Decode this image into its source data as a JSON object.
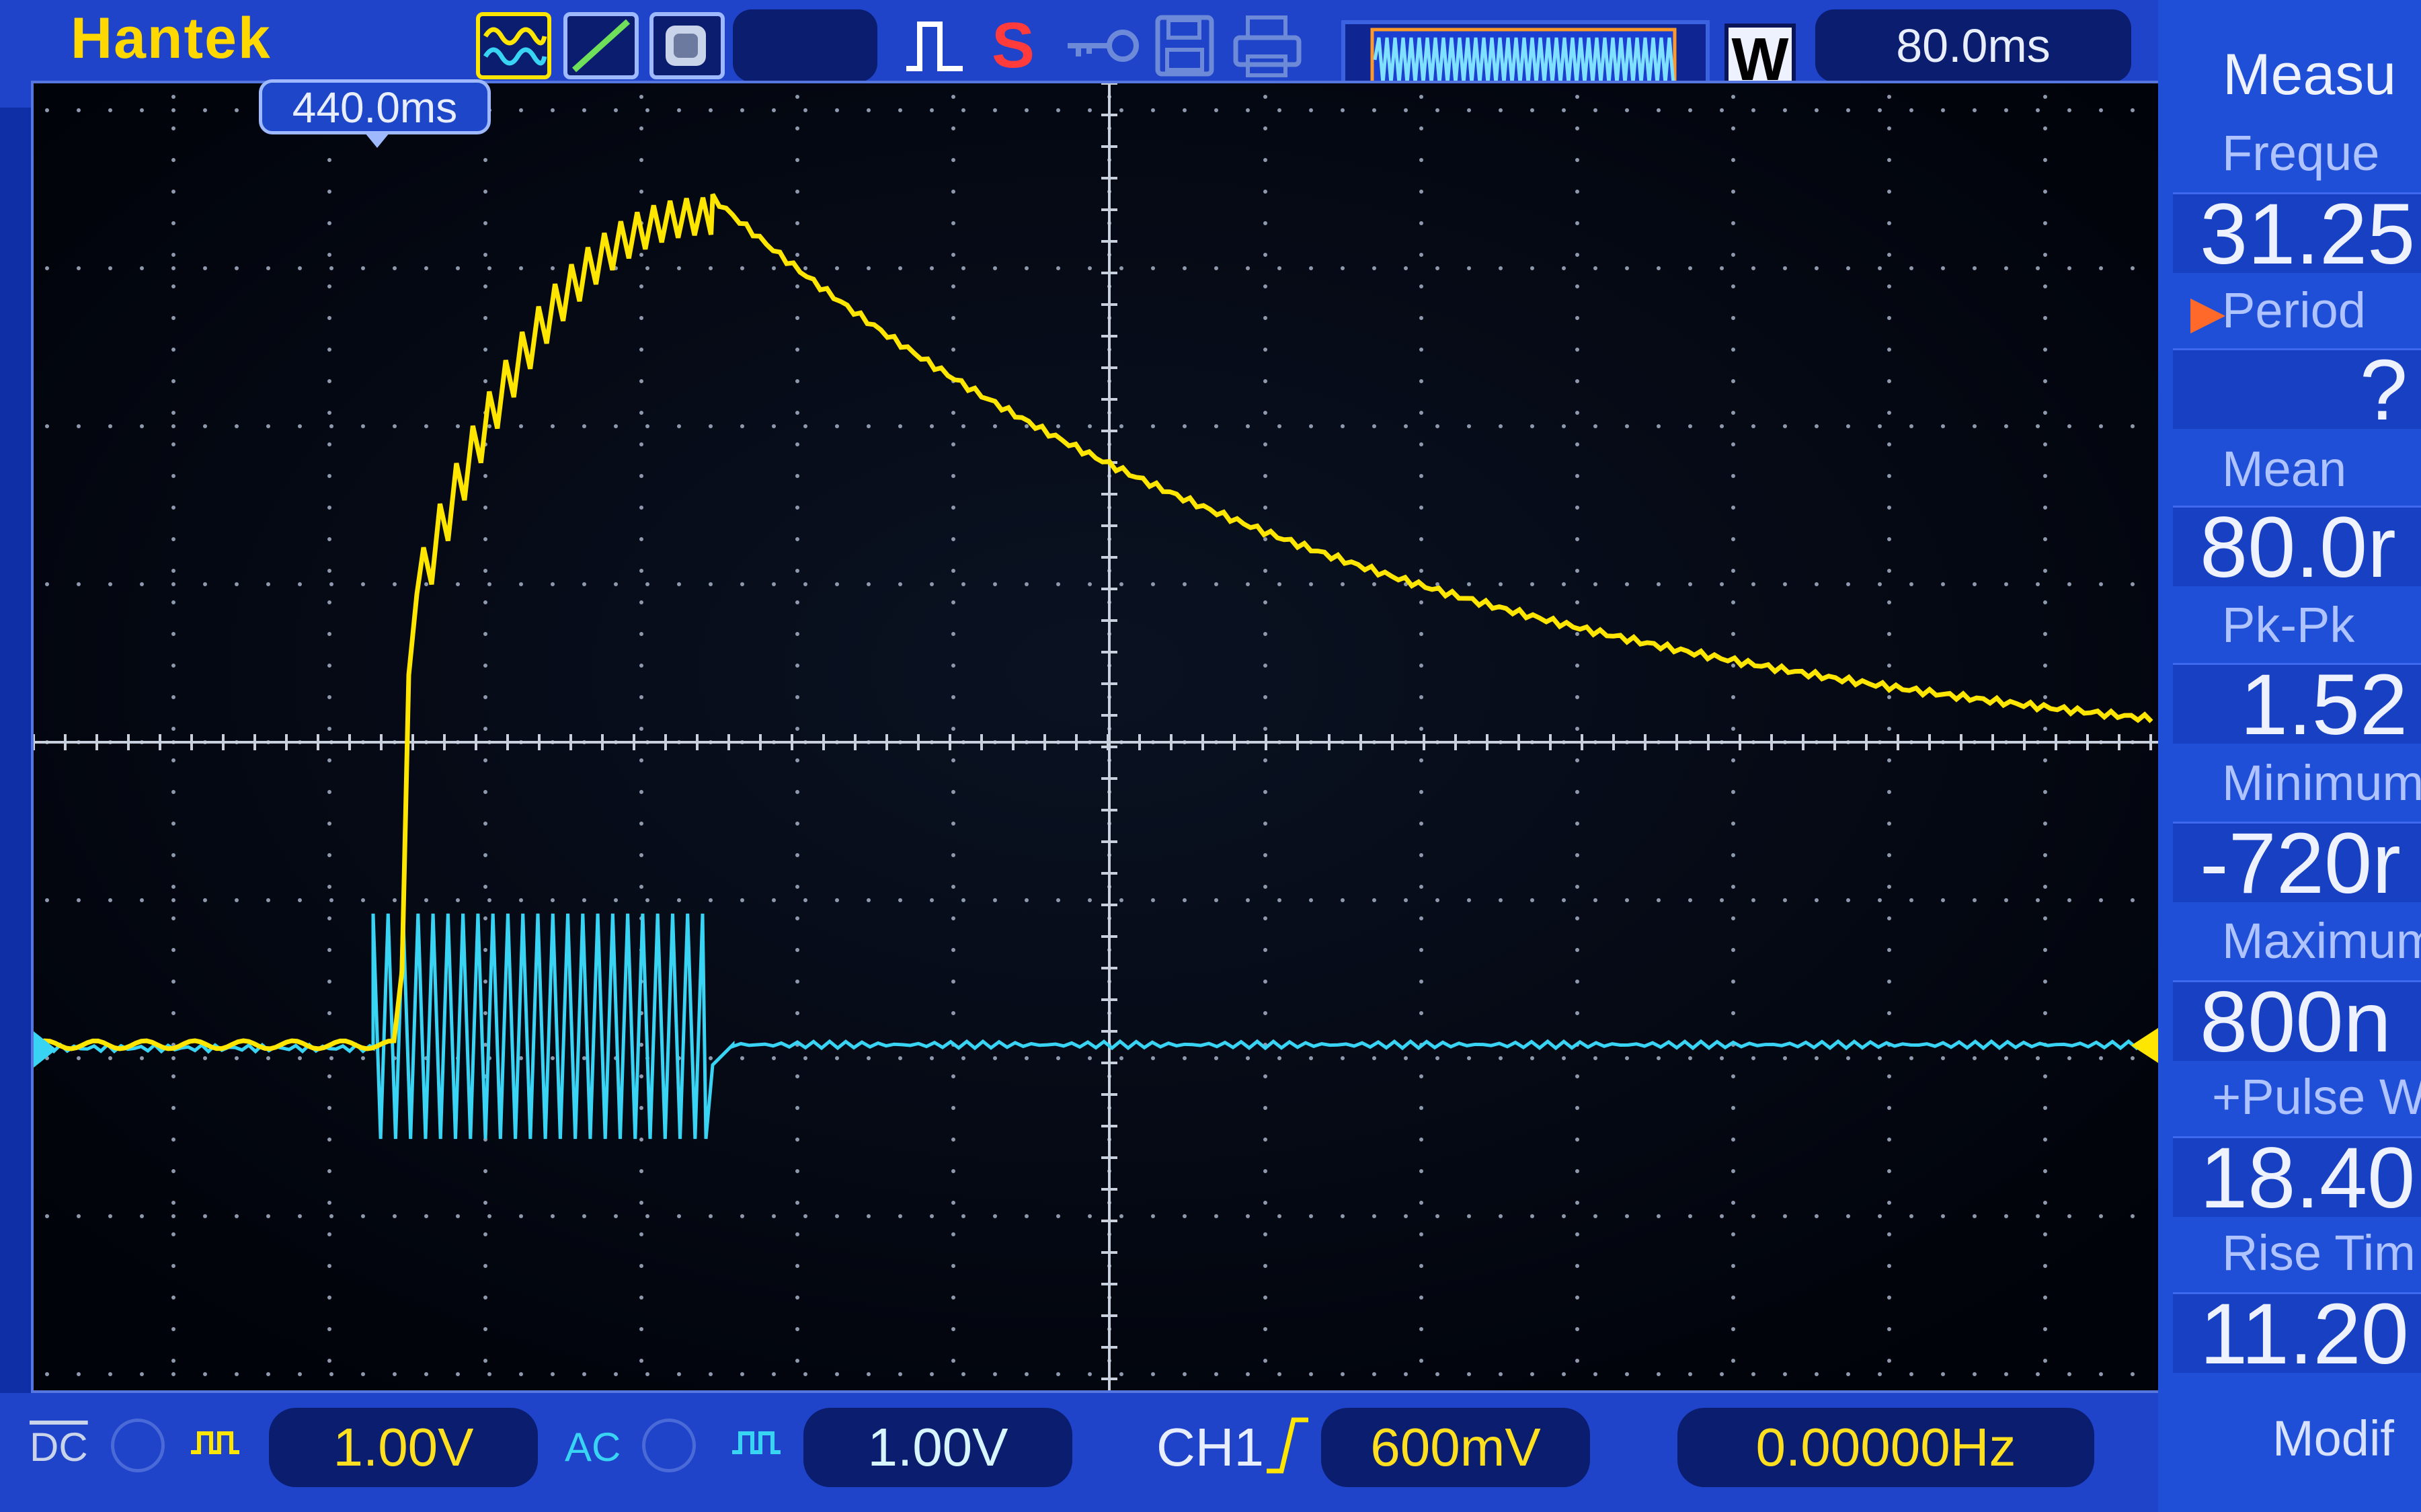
{
  "brand": "Hantek",
  "header": {
    "run_status": "S",
    "timebase": "80.0ms",
    "wave_mode": "W",
    "trigger_position": "440.0ms"
  },
  "measure": {
    "title": "Measu",
    "items": [
      {
        "label": "Freque",
        "value": "31.25"
      },
      {
        "label": "Period",
        "value": "?"
      },
      {
        "label": "Mean",
        "value": "80.0r"
      },
      {
        "label": "Pk-Pk",
        "value": "1.52"
      },
      {
        "label": "Minimum",
        "value": "-720r"
      },
      {
        "label": "Maximum",
        "value": "800n"
      },
      {
        "label": "+Pulse W",
        "value": "18.40"
      },
      {
        "label": "Rise Tim",
        "value": "11.20"
      }
    ],
    "footer": "Modif"
  },
  "status": {
    "ch1_coupling": "DC",
    "ch1_volts": "1.00V",
    "ch2_coupling": "AC",
    "ch2_volts": "1.00V",
    "trigger_source": "CH1",
    "trigger_level": "600mV",
    "frequency": "0.00000Hz"
  },
  "colors": {
    "ch1": "#ffe600",
    "ch2": "#39d3f4",
    "grid": "#9aa6b8",
    "panel": "#1f43c9",
    "screen": "#02050d"
  },
  "icons": [
    "ch1-wave-icon",
    "ch2-line-icon",
    "probe-icon",
    "pulse-icon",
    "key-icon",
    "save-icon",
    "print-icon"
  ]
}
